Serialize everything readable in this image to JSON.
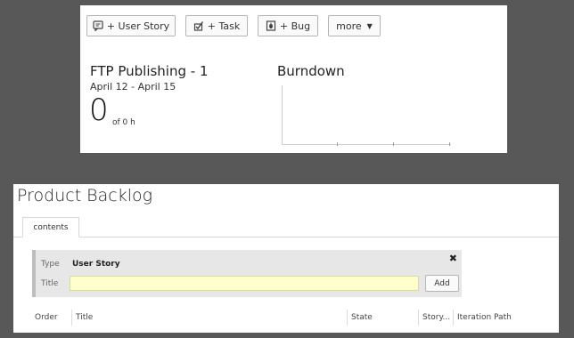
{
  "toolbar": {
    "user_story_label": "+ User Story",
    "task_label": "+ Task",
    "bug_label": "+ Bug",
    "more_label": "more"
  },
  "iteration": {
    "name": "FTP Publishing - 1",
    "dates": "April 12 - April 15",
    "count": "0",
    "of_text": "of 0 h"
  },
  "burndown": {
    "title": "Burndown"
  },
  "backlog": {
    "title": "Product Backlog",
    "tab_label": "contents",
    "quick_add": {
      "type_label": "Type",
      "type_value": "User Story",
      "title_label": "Title",
      "title_value": "",
      "add_label": "Add"
    },
    "columns": [
      "Order",
      "Title",
      "State",
      "Story...",
      "Iteration Path"
    ]
  },
  "icons": {
    "user_story": "user-story-icon",
    "task": "task-icon",
    "bug": "bug-icon",
    "close": "close-icon",
    "more_caret": "caret-down-icon"
  }
}
